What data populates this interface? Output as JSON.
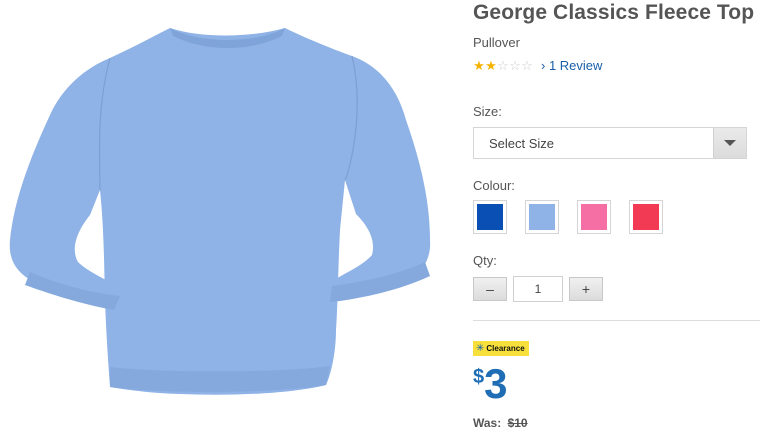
{
  "product": {
    "title": "George Classics Fleece Top",
    "subtitle": "Pullover",
    "image_icon": "sweatshirt-image",
    "rating": {
      "stars_filled": 2,
      "stars_total": 5,
      "review_link": "› 1 Review"
    }
  },
  "size": {
    "label": "Size:",
    "selected": "Select Size"
  },
  "colour": {
    "label": "Colour:",
    "swatches": [
      {
        "name": "blue",
        "hex": "#0a4fb4"
      },
      {
        "name": "light-blue",
        "hex": "#8fb3e6"
      },
      {
        "name": "pink",
        "hex": "#f56ea4"
      },
      {
        "name": "red",
        "hex": "#f23a55"
      }
    ]
  },
  "quantity": {
    "label": "Qty:",
    "value": "1",
    "decrement_label": "–",
    "increment_label": "+"
  },
  "pricing": {
    "badge": "Clearance",
    "currency": "$",
    "price": "3",
    "was_label": "Was:",
    "was_price": "$10"
  },
  "colors": {
    "accent": "#1f6eb5",
    "badge": "#f7e03c",
    "product": "#8fb3e6"
  }
}
